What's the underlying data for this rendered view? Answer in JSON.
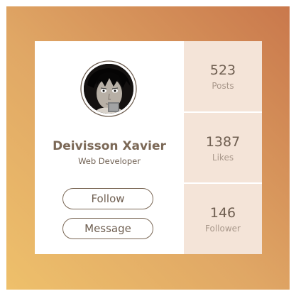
{
  "profile": {
    "name": "Deivisson Xavier",
    "role": "Web Developer",
    "avatar_icon": "user-avatar-icon"
  },
  "actions": {
    "follow_label": "Follow",
    "message_label": "Message"
  },
  "stats": [
    {
      "value": "523",
      "label": "Posts"
    },
    {
      "value": "1387",
      "label": "Likes"
    },
    {
      "value": "146",
      "label": "Follower"
    }
  ],
  "colors": {
    "gradient_start": "#eec06b",
    "gradient_end": "#c9784c",
    "stats_panel": "#f4e4d8",
    "text_primary": "#7b6856",
    "text_muted": "#a8978a"
  }
}
